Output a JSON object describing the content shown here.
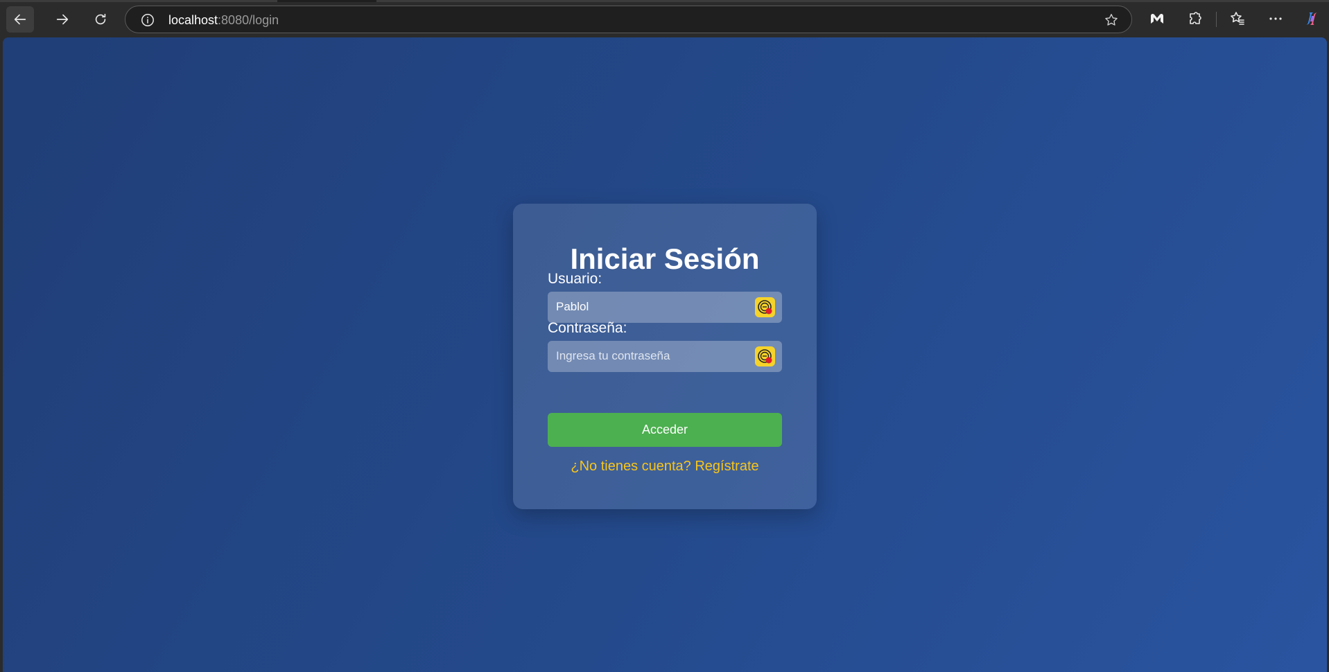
{
  "browser": {
    "url_host": "localhost",
    "url_rest": ":8080/login",
    "back_icon": "arrow-left-icon",
    "forward_icon": "arrow-right-icon",
    "reload_icon": "reload-icon",
    "info_icon": "info-icon",
    "favorite_icon": "star-icon",
    "extension_icons": [
      "malwarebytes-icon",
      "puzzle-icon",
      "favorites-icon",
      "more-icon",
      "copilot-icon"
    ]
  },
  "login": {
    "title": "Iniciar Sesión",
    "username_label": "Usuario:",
    "username_value": "Pablol",
    "password_label": "Contraseña:",
    "password_placeholder": "Ingresa tu contraseña",
    "submit_label": "Acceder",
    "register_link": "¿No tienes cuenta? Regístrate"
  },
  "colors": {
    "background_start": "#203e77",
    "background_end": "#2a54a0",
    "button": "#4caf50",
    "link": "#f7c51d",
    "field_icon": "#f6d329"
  }
}
